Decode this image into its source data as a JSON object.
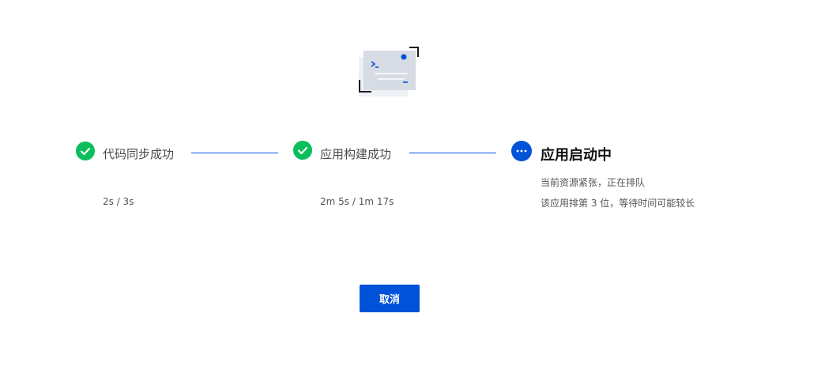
{
  "illustration": {
    "icon": "terminal-window-illustration",
    "prompt_glyph": ">_"
  },
  "steps": [
    {
      "status": "success",
      "icon": "check-icon",
      "title": "代码同步成功",
      "detail": "2s / 3s"
    },
    {
      "status": "success",
      "icon": "check-icon",
      "title": "应用构建成功",
      "detail": "2m 5s / 1m 17s"
    },
    {
      "status": "active",
      "icon": "more-dots-icon",
      "title": "应用启动中",
      "detail_lines": [
        "当前资源紧张，正在排队",
        "该应用排第 3 位，等待时间可能较长"
      ]
    }
  ],
  "actions": {
    "cancel_label": "取消"
  },
  "colors": {
    "success": "#0abf5b",
    "primary": "#0052d9",
    "text": "#4a4a4a"
  }
}
